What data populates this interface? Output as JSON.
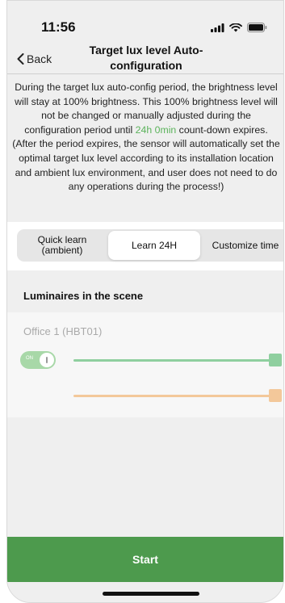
{
  "status_bar": {
    "time": "11:56",
    "icons": [
      "signal-icon",
      "wifi-icon",
      "battery-icon"
    ]
  },
  "nav": {
    "back_label": "Back",
    "back_icon": "chevron-left-icon",
    "title": "Target lux level Auto-configuration"
  },
  "info": {
    "text_before": "During the target lux auto-config period, the brightness level will stay at 100% brightness. This 100% brightness level will not be changed or manually adjusted during the configuration period until ",
    "countdown": "24h 0min",
    "text_after": " count-down expires. (After the period expires, the sensor will automatically set the optimal target lux level according to its installation location and ambient lux environment, and user does not need to do any operations during the process!)"
  },
  "tabs": {
    "items": [
      {
        "label": "Quick learn (ambient)",
        "active": false
      },
      {
        "label": "Learn 24H",
        "active": true
      },
      {
        "label": "Customize time",
        "active": false
      }
    ]
  },
  "luminaires": {
    "section_title": "Luminaires in the scene",
    "items": [
      {
        "name": "Office 1 (HBT01)",
        "toggle_label": "ON",
        "toggle_on": true,
        "brightness_level": 1.0,
        "color_temp_level": 1.0
      }
    ]
  },
  "colors": {
    "accent_green": "#5bb35b",
    "slider_green": "#8fcf9f",
    "slider_orange": "#f3c89a",
    "start_button": "#4d9a4d"
  },
  "footer": {
    "start_label": "Start"
  }
}
